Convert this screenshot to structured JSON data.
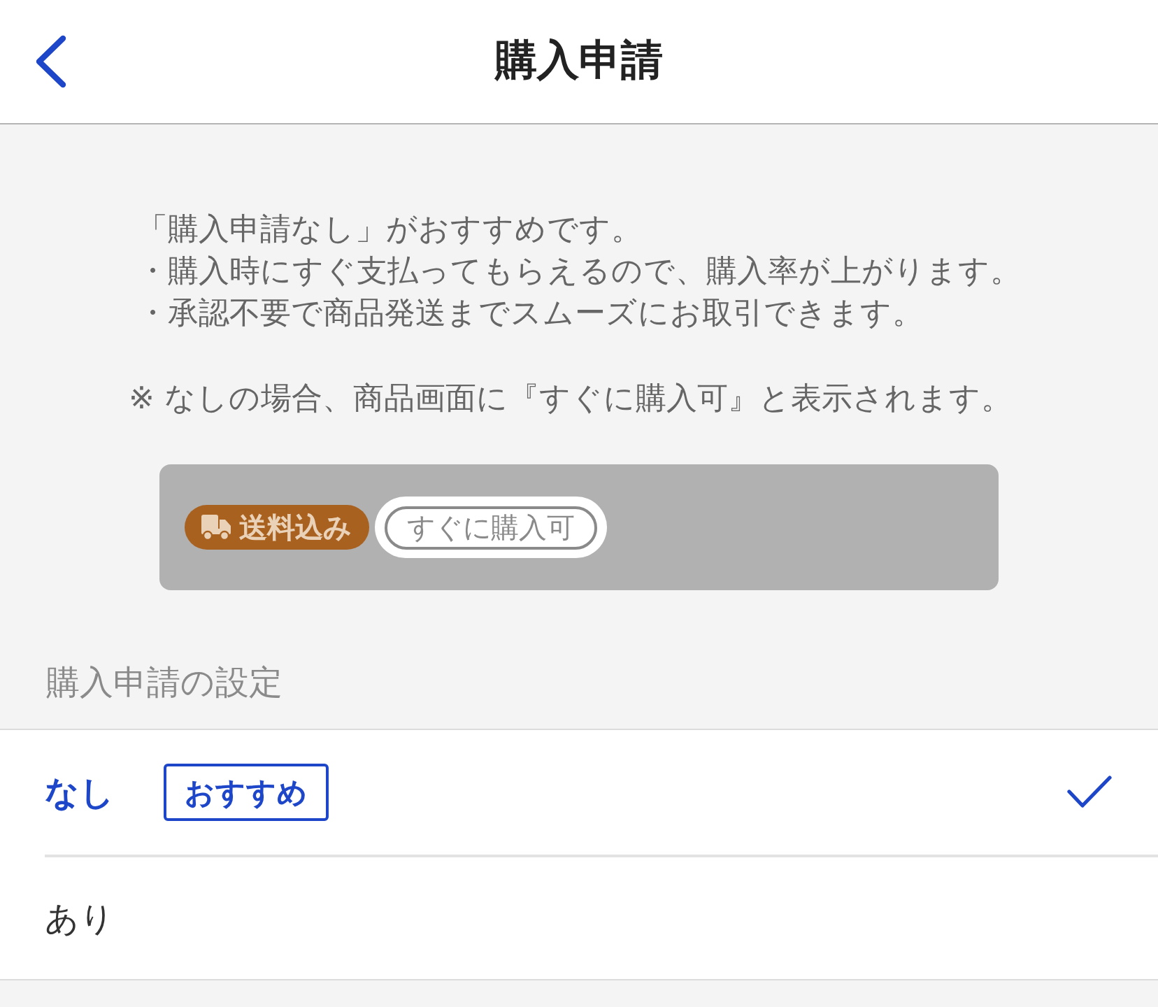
{
  "header": {
    "title": "購入申請"
  },
  "notice": {
    "lines": [
      "「購入申請なし」がおすすめです。",
      "・購入時にすぐ支払ってもらえるので、購入率が上がります。",
      "・承認不要で商品発送までスムーズにお取引できます。"
    ],
    "note": "※ なしの場合、商品画面に『すぐに購入可』と表示されます。"
  },
  "preview": {
    "tags": [
      {
        "kind": "shipping",
        "label": "送料込み"
      },
      {
        "kind": "instant",
        "label": "すぐに購入可"
      }
    ]
  },
  "settings": {
    "heading": "購入申請の設定",
    "options": [
      {
        "label": "なし",
        "badge": "おすすめ",
        "selected": true
      },
      {
        "label": "あり",
        "selected": false
      }
    ]
  }
}
